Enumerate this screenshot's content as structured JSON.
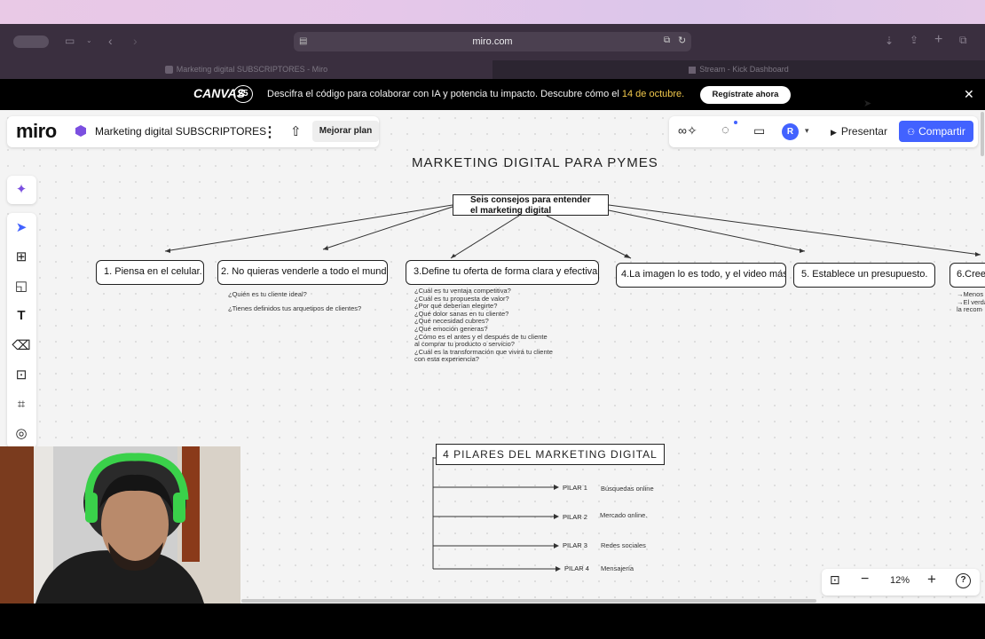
{
  "browser": {
    "url": "miro.com",
    "tabs": [
      {
        "label": "Marketing digital SUBSCRIPTORES - Miro"
      },
      {
        "label": "Stream - Kick Dashboard"
      }
    ]
  },
  "banner": {
    "logo": "CANVAS",
    "logo_badge": "25",
    "text": "Descifra el código para colaborar con IA y potencia tu impacto. Descubre cómo el ",
    "date": "14 de octubre.",
    "button": "Regístrate ahora",
    "close": "✕"
  },
  "miro": {
    "logo": "miro",
    "board_name": "Marketing digital SUBSCRIPTORES",
    "upgrade": "Mejorar plan",
    "avatar": "R",
    "present": "Presentar",
    "share": "Compartir",
    "zoom": "12%"
  },
  "board": {
    "title1": "MARKETING DIGITAL PARA PYMES",
    "root_line1": "Seis consejos para  entender",
    "root_line2": "el marketing digital",
    "nodes": [
      "1. Piensa en el celular.",
      "2. No quieras venderle a todo el mundo.",
      "3.Define tu oferta de forma clara y efectiva.",
      "4.La imagen lo es todo, y el video más.",
      "5. Establece un presupuesto.",
      "6.Cree"
    ],
    "node2_q1": "¿Quién es tu cliente ideal?",
    "node2_q2": "¿Tienes definidos tus arquetipos de clientes?",
    "node3_qs": [
      "¿Cuál es tu ventaja competitiva?",
      "¿Cuál es tu propuesta de valor?",
      "¿Por qué deberían elegirte?",
      "¿Qué dolor sanas en tu cliente?",
      "¿Qué necesidad cubres?",
      "¿Qué emoción generas?",
      "¿Cómo es el antes y el después de tu cliente",
      "al comprar tu producto o servicio?",
      "¿Cuál es la transformación que vivirá tu cliente",
      "con esta experiencia?"
    ],
    "node6_qs": [
      "→Menos",
      "→El verda",
      "la recom"
    ],
    "title2": "4 PILARES DEL MARKETING DIGITAL",
    "pilares": [
      {
        "label": "PILAR 1",
        "desc": "Búsquedas online"
      },
      {
        "label": "PILAR 2",
        "desc": "Mercado online."
      },
      {
        "label": "PILAR 3",
        "desc": "Redes sociales"
      },
      {
        "label": "PILAR 4",
        "desc": "Mensajería"
      }
    ]
  },
  "colors": {
    "miro_blue": "#4262ff",
    "banner_date": "#f2c94c",
    "board_bg": "#f4f4f4"
  }
}
